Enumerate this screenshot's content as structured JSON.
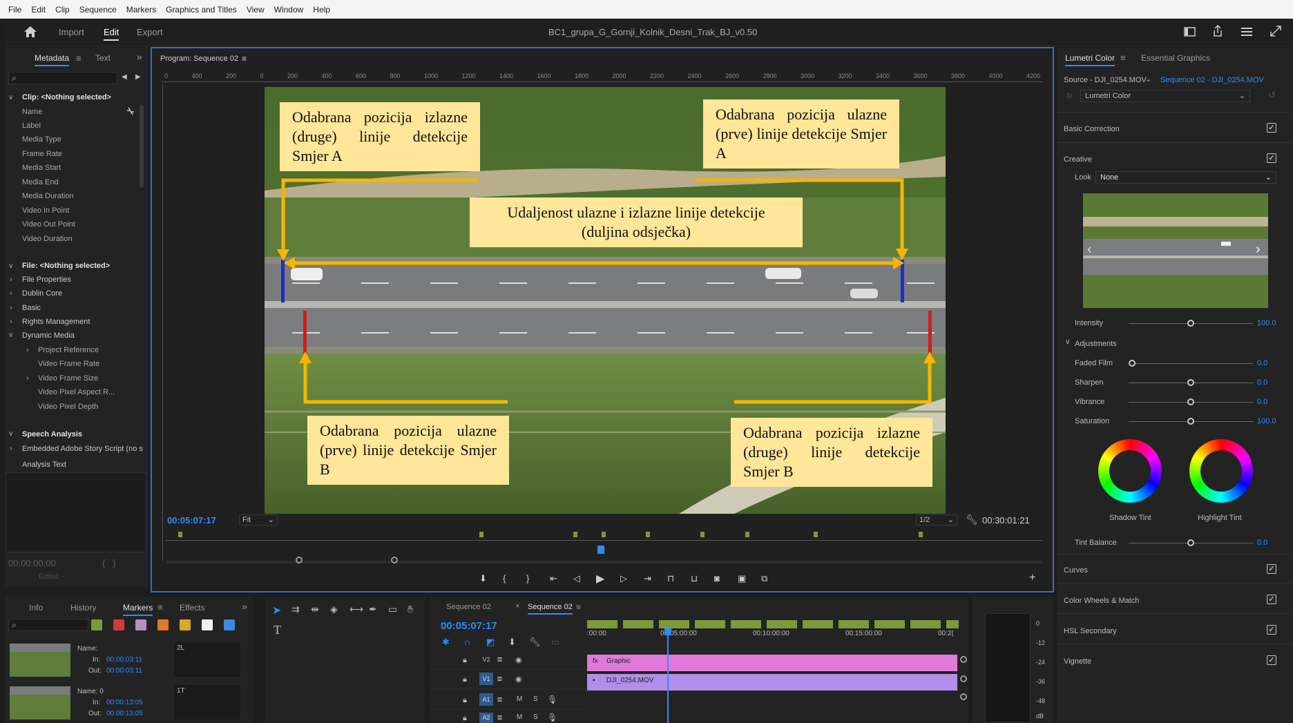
{
  "menu": [
    "File",
    "Edit",
    "Clip",
    "Sequence",
    "Markers",
    "Graphics and Titles",
    "View",
    "Window",
    "Help"
  ],
  "header": {
    "tabs": [
      "Import",
      "Edit",
      "Export"
    ],
    "title": "BC1_grupa_G_Gornji_Kolnik_Desni_Trak_BJ_v0.50"
  },
  "left": {
    "tabs": [
      "Metadata",
      "Text"
    ],
    "clip_header": "Clip:  <Nothing selected>",
    "clip_fields": [
      "Name",
      "Label",
      "Media Type",
      "Frame Rate",
      "Media Start",
      "Media End",
      "Media Duration",
      "Video In Point",
      "Video Out Point",
      "Video Duration"
    ],
    "file_header": "File:  <Nothing selected>",
    "file_sections": [
      "File Properties",
      "Dublin Core",
      "Basic",
      "Rights Management",
      "Dynamic Media"
    ],
    "dyn_items": [
      "Project Reference",
      "Video Frame Rate",
      "Video Frame Size",
      "Video Pixel Aspect R...",
      "Video Pixel Depth"
    ],
    "speech": "Speech Analysis",
    "story": "Embedded Adobe Story Script (no s",
    "analysis": "Analysis Text",
    "timecode": "00:00:00:00",
    "edited": "Edited: -"
  },
  "program": {
    "title": "Program: Sequence 02",
    "ruler": [
      "0",
      "400",
      "200",
      "0",
      "200",
      "400",
      "600",
      "800",
      "1000",
      "1200",
      "1400",
      "1600",
      "1800",
      "2000",
      "2200",
      "2400",
      "2600",
      "2800",
      "3000",
      "3200",
      "3400",
      "3600",
      "3800",
      "4000",
      "4200"
    ],
    "captions": {
      "tl": "Odabrana pozicija izlazne (druge) linije detekcije Smjer A",
      "tr": "Odabrana pozicija ulazne (prve) linije detekcije Smjer A",
      "mid": "Udaljenost ulazne i izlazne linije detekcije (duljina odsječka)",
      "bl": "Odabrana pozicija ulazne (prve) linije detekcije Smjer B",
      "br": "Odabrana pozicija izlazne (druge) linije detekcije Smjer B"
    },
    "timecode": "00:05:07:17",
    "fit": "Fit",
    "res": "1/2",
    "duration": "00:30:01:21"
  },
  "lumetri": {
    "tabs": [
      "Lumetri Color",
      "Essential Graphics"
    ],
    "source": "Source - DJI_0254.MOV",
    "sequence": "Sequence 02 - DJI_0254.MOV",
    "fx": "Lumetri Color",
    "basic": "Basic Correction",
    "creative": "Creative",
    "look_label": "Look",
    "look_value": "None",
    "intensity_label": "Intensity",
    "intensity": "100.0",
    "adjustments": "Adjustments",
    "sliders": [
      {
        "label": "Faded Film",
        "value": "0.0",
        "level": 0
      },
      {
        "label": "Sharpen",
        "value": "0.0",
        "level": 0.5
      },
      {
        "label": "Vibrance",
        "value": "0.0",
        "level": 0.5
      },
      {
        "label": "Saturation",
        "value": "100.0",
        "level": 0.5
      }
    ],
    "shadow": "Shadow Tint",
    "highlight": "Highlight Tint",
    "tint_label": "Tint Balance",
    "tint": "0.0",
    "sections": [
      "Curves",
      "Color Wheels & Match",
      "HSL Secondary",
      "Vignette"
    ]
  },
  "bottom_left": {
    "tabs": [
      "Info",
      "History",
      "Markers",
      "Effects"
    ],
    "markers": [
      {
        "name": "Name:",
        "name_val": "2L",
        "in": "00:00:03:11",
        "out": "00:00:03:11"
      },
      {
        "name": "Name:  0",
        "name_val": "1T",
        "in": "00:00:13:05",
        "out": "00:00:13:05"
      }
    ],
    "in_label": "In:",
    "out_label": "Out:",
    "swatch_colors": [
      "#7c9a3a",
      "#d13b3b",
      "#b98ec2",
      "#e07a2a",
      "#d9a72b",
      "#f0f0f0",
      "#3d8ae0"
    ]
  },
  "timeline": {
    "tabs": [
      "Sequence 02",
      "Sequence 02"
    ],
    "timecode": "00:05:07:17",
    "ruler": [
      ":00:00",
      "00:05:00:00",
      "00:10:00:00",
      "00:15:00:00",
      "00:2("
    ],
    "tracks": [
      "V2",
      "V1",
      "A1",
      "A2"
    ],
    "clips": [
      "Graphic",
      "DJI_0254.MOV"
    ]
  },
  "meter": [
    "0",
    "-12",
    "-24",
    "-36",
    "-48",
    "dB"
  ]
}
